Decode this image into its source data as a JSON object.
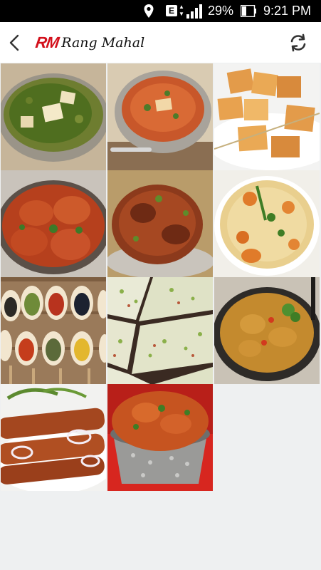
{
  "status_bar": {
    "network_type": "E",
    "battery_percent": "29%",
    "time": "9:21 PM",
    "icons": [
      "location-icon",
      "signal-icon",
      "battery-icon"
    ]
  },
  "app_bar": {
    "logo_mark": "RM",
    "logo_name": "Rang Mahal",
    "icons": [
      "back-arrow-icon",
      "refresh-icon"
    ]
  },
  "colors": {
    "brand_red": "#d3101b",
    "background": "#eef0f1",
    "app_bar": "#ffffff"
  },
  "gallery": {
    "items": [
      {
        "dish": "palak-paneer"
      },
      {
        "dish": "paneer-curry"
      },
      {
        "dish": "paneer-tikka-skewers"
      },
      {
        "dish": "butter-chicken"
      },
      {
        "dish": "roast-chicken"
      },
      {
        "dish": "biryani"
      },
      {
        "dish": "spices"
      },
      {
        "dish": "pista-barfi"
      },
      {
        "dish": "chicken-curry-bowl"
      },
      {
        "dish": "seekh-kebab"
      },
      {
        "dish": "chicken-handi"
      }
    ]
  }
}
